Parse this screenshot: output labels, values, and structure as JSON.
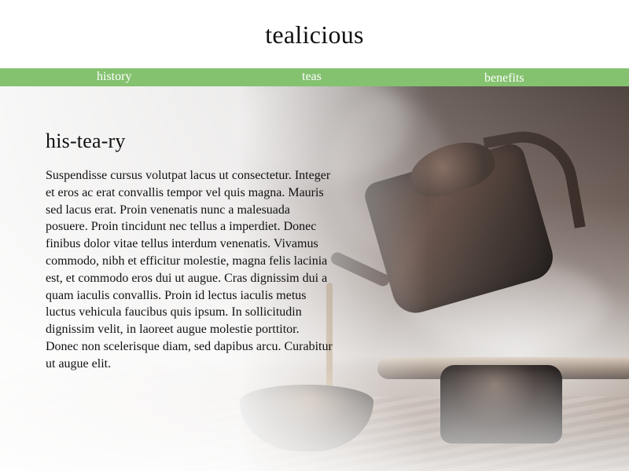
{
  "header": {
    "site_title": "tealicious"
  },
  "nav": {
    "items": [
      {
        "label": "history"
      },
      {
        "label": "teas"
      },
      {
        "label": "benefits"
      }
    ]
  },
  "main": {
    "heading": "his-tea-ry",
    "body": "Suspendisse cursus volutpat lacus ut consectetur. Integer et eros ac erat convallis tempor vel quis magna. Mauris sed lacus erat. Proin venenatis nunc a malesuada posuere. Proin tincidunt nec tellus a imperdiet. Donec finibus dolor vitae tellus interdum venenatis. Vivamus commodo, nibh et efficitur molestie, magna felis lacinia est, et commodo eros dui ut augue. Cras dignissim dui a quam iaculis convallis. Proin id lectus iaculis metus luctus vehicula faucibus quis ipsum. In sollicitudin dignissim velit, in laoreet augue molestie porttitor. Donec non scelerisque diam, sed dapibus arcu. Curabitur ut augue elit."
  },
  "colors": {
    "nav_background": "#84c26f",
    "nav_text": "#ffffff",
    "text": "#111111"
  }
}
